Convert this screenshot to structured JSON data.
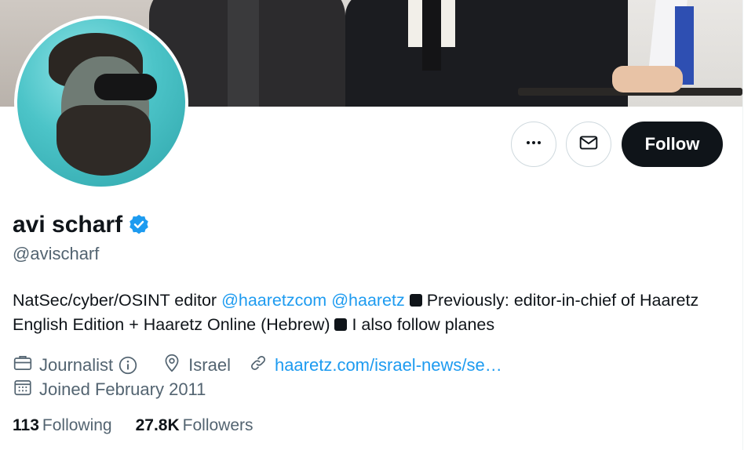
{
  "profile": {
    "name": "avi scharf",
    "handle": "@avischarf",
    "verified": true
  },
  "actions": {
    "more_icon": "more-horizontal-icon",
    "message_icon": "envelope-icon",
    "follow_label": "Follow"
  },
  "bio": {
    "text_1": "NatSec/cyber/OSINT editor ",
    "mention_1": "@haaretzcom",
    "mention_2": "@haaretz",
    "text_2": " Previously: editor-in-chief of Haaretz English Edition + Haaretz Online (Hebrew) ",
    "text_3": " I also follow planes"
  },
  "meta": {
    "profession": "Journalist",
    "location": "Israel",
    "website": "haaretz.com/israel-news/se…",
    "joined": "Joined February 2011"
  },
  "counts": {
    "following_value": "113",
    "following_label": "Following",
    "followers_value": "27.8K",
    "followers_label": "Followers"
  },
  "colors": {
    "accent": "#1d9bf0",
    "text_primary": "#0f1419",
    "text_secondary": "#536471",
    "follow_bg": "#0f1419"
  }
}
